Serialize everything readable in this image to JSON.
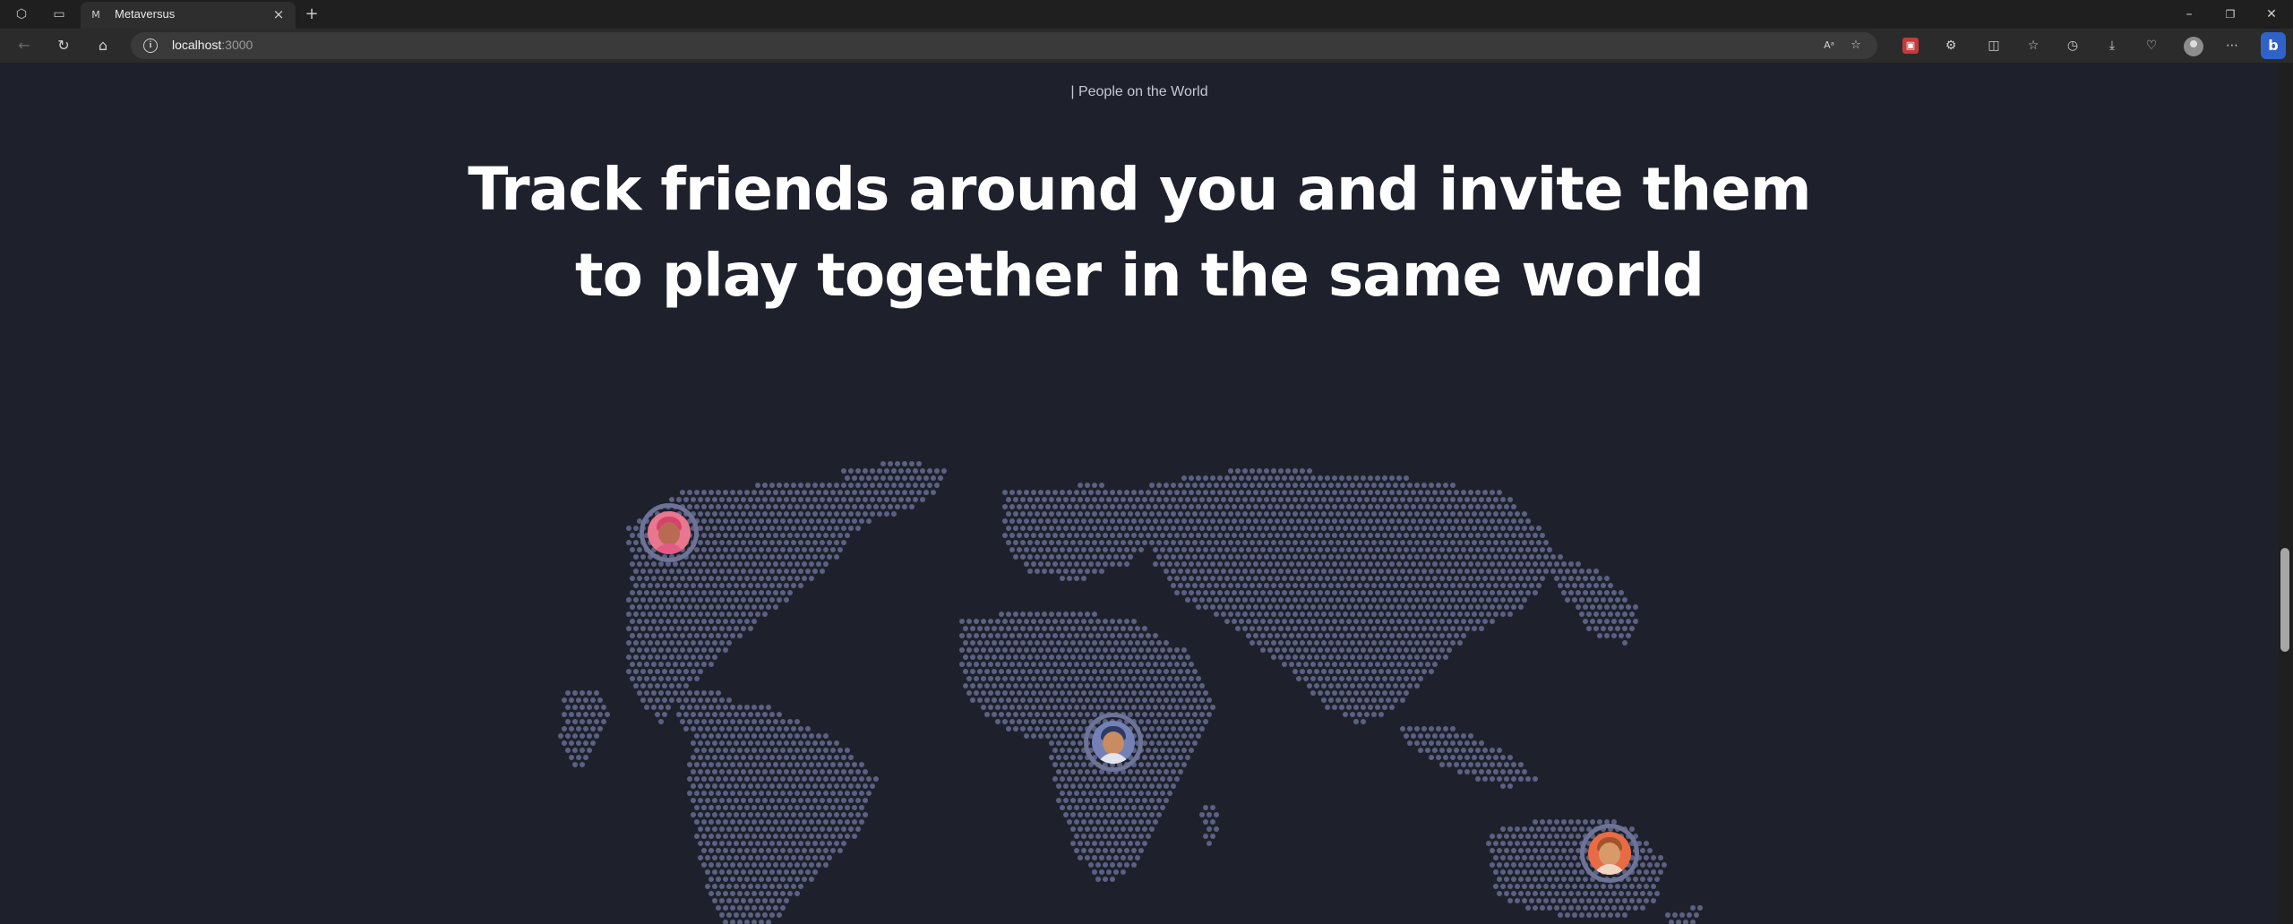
{
  "browser": {
    "tab_title": "Metaversus",
    "url_host": "localhost",
    "url_port": ":3000",
    "read_aloud_label": "Aᵃ"
  },
  "page": {
    "section_tag": "| People on the World",
    "headline_line1": "Track friends around you and invite them",
    "headline_line2": "to play together in the same world"
  },
  "friends": [
    {
      "name": "people-01",
      "ring": "#6d7396",
      "bg": "#e8778f",
      "skin": "#b86b52",
      "hair": "#d8416a",
      "body": "#e35a86"
    },
    {
      "name": "people-02",
      "ring": "#6d7396",
      "bg": "#7381b6",
      "skin": "#c98c62",
      "hair": "#2e3a66",
      "body": "#e2e4ee"
    },
    {
      "name": "people-03",
      "ring": "#6d7396",
      "bg": "#e86b45",
      "skin": "#d89a6a",
      "hair": "#a2532c",
      "body": "#f1d6c4"
    }
  ],
  "colors": {
    "page_bg": "#1e212c",
    "map_dot": "#5c6182",
    "text_primary": "#ffffff",
    "text_secondary": "#c7c9d1"
  }
}
